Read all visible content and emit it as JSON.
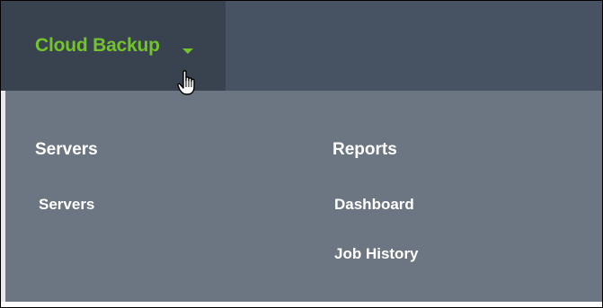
{
  "nav": {
    "title": "Cloud Backup",
    "caret_icon": "caret-down-icon",
    "accent_color": "#73c42a"
  },
  "cursor": {
    "icon": "hand-pointer-icon"
  },
  "dropdown": {
    "servers_column": {
      "heading": "Servers",
      "items": [
        "Servers"
      ]
    },
    "reports_column": {
      "heading": "Reports",
      "items": [
        "Dashboard",
        "Job History"
      ]
    }
  }
}
